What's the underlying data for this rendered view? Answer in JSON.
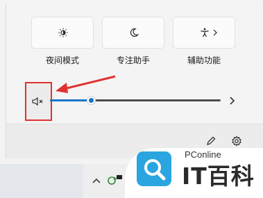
{
  "quick_settings": {
    "tiles": [
      {
        "label": "夜间模式",
        "icon": "brightness-icon"
      },
      {
        "label": "专注助手",
        "icon": "moon-icon"
      },
      {
        "label": "辅助功能",
        "icon": "accessibility-icon"
      }
    ]
  },
  "volume": {
    "icon": "speaker-muted-icon",
    "level": 0.24
  },
  "colors": {
    "accent": "#1a73c8",
    "highlight": "#e03030",
    "brand": "#2ba5df"
  },
  "watermark": {
    "small_text": "PConline",
    "big_text": "IT百科"
  }
}
